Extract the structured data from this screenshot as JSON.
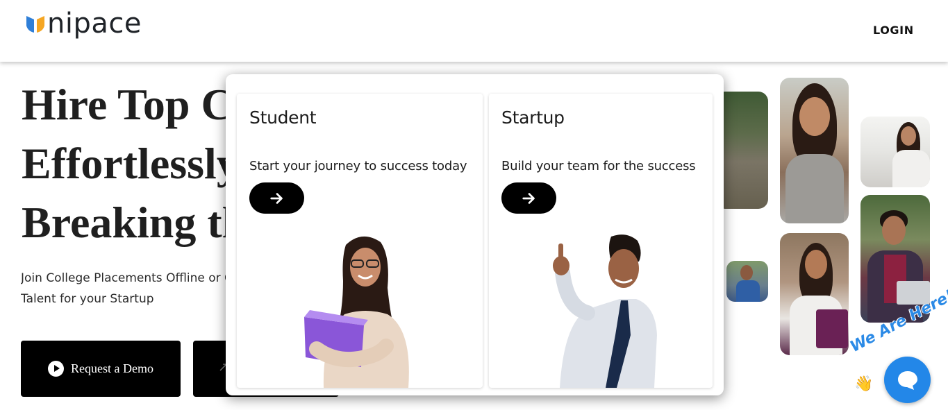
{
  "header": {
    "logo_text": "nipace",
    "login_label": "LOGIN"
  },
  "hero": {
    "title_lines": [
      "Hire Top C",
      "Effortlessly",
      "Breaking th"
    ],
    "subtitle_lines": [
      "Join College Placements Offline or O",
      "Talent for your Startup"
    ],
    "demo_button_label": "Request a Demo"
  },
  "modal": {
    "student": {
      "title": "Student",
      "description": "Start your journey to success today"
    },
    "startup": {
      "title": "Startup",
      "description": "Build your team for the success"
    }
  },
  "chat": {
    "label": "We Are Here!"
  },
  "colors": {
    "logo_orange": "#f5a623",
    "logo_blue": "#2f7fd8",
    "chat_blue": "#2387e8",
    "button_black": "#000000"
  },
  "icons": [
    "logo-icon",
    "play-icon",
    "arrow-right-icon",
    "chat-icon",
    "wave-hand-icon"
  ]
}
